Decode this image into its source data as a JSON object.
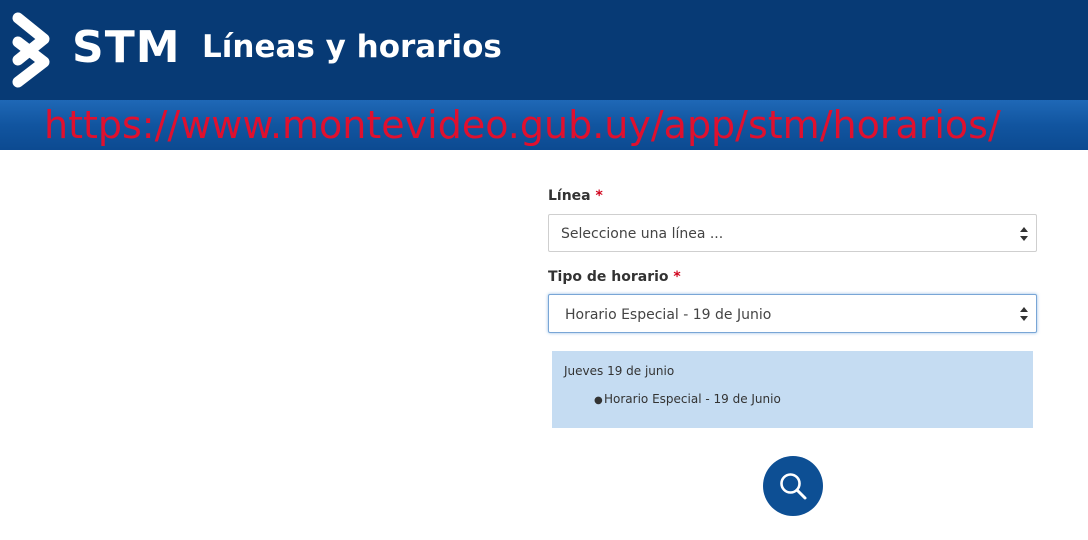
{
  "header": {
    "brand": "STM",
    "title": "Líneas y horarios",
    "logo_icon": "stm-chevron-logo-icon",
    "background_color": "#073a75"
  },
  "url_overlay": {
    "text": "https://www.montevideo.gub.uy/app/stm/horarios/",
    "color": "#e0102e"
  },
  "form": {
    "linea": {
      "label": "Línea",
      "required_mark": "*",
      "value": "Seleccione una línea ..."
    },
    "tipo_horario": {
      "label": "Tipo de horario",
      "required_mark": "*",
      "value": "Horario Especial - 19 de Junio"
    },
    "info": {
      "title": "Jueves 19 de junio",
      "items": [
        "Horario Especial - 19 de Junio"
      ],
      "background_color": "#c5dcf2"
    },
    "search": {
      "icon": "search-icon",
      "color": "#0d4f94"
    }
  }
}
